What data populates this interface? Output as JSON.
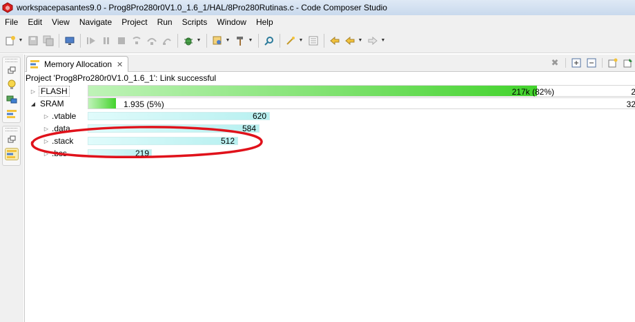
{
  "window": {
    "title": "workspacepasantes9.0 - Prog8Pro280r0V1.0_1.6_1/HAL/8Pro280Rutinas.c - Code Composer Studio"
  },
  "menu": [
    "File",
    "Edit",
    "View",
    "Navigate",
    "Project",
    "Run",
    "Scripts",
    "Window",
    "Help"
  ],
  "toolbar_icons": [
    "new-icon",
    "save-icon",
    "save-all-icon",
    "debug-icon",
    "resume-icon",
    "suspend-icon",
    "terminate-icon",
    "step-into-icon",
    "step-over-icon",
    "step-return-icon",
    "bug-icon",
    "build-target-icon",
    "hammer-icon",
    "search-icon",
    "wand-icon",
    "back-nav-icon",
    "back-icon",
    "forward-icon"
  ],
  "view": {
    "tab_label": "Memory Allocation",
    "status_line": "Project 'Prog8Pro280r0V1.0_1.6_1': Link successful",
    "sections": [
      {
        "name": "FLASH",
        "value_label": "217k (82%)",
        "percent": 82,
        "right_label": "2",
        "expanded": false
      },
      {
        "name": "SRAM",
        "value_label": "1.935 (5%)",
        "percent": 5,
        "right_label": "32",
        "expanded": true
      }
    ],
    "sram_children": [
      {
        "name": ".vtable",
        "value": "620"
      },
      {
        "name": ".data",
        "value": "584"
      },
      {
        "name": ".stack",
        "value": "512"
      },
      {
        "name": ".bss",
        "value": "219"
      }
    ]
  },
  "colors": {
    "green_bar": "#42d32c",
    "cyan_bar": "#b7f0f0",
    "annotation": "#e0121b"
  }
}
